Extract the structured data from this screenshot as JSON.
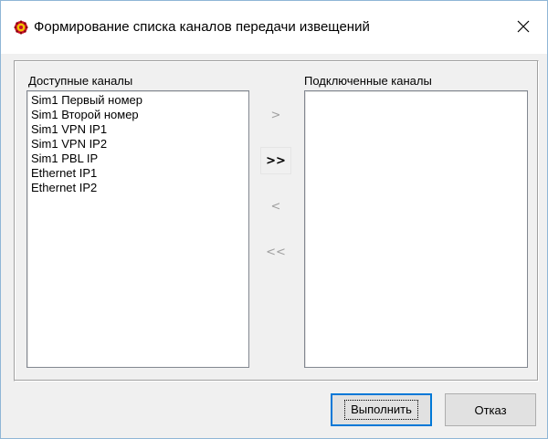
{
  "window": {
    "title": "Формирование списка каналов передачи извещений",
    "app_icon": "gear-red-icon",
    "close_icon": "close-icon"
  },
  "available": {
    "label": "Доступные каналы",
    "items": [
      "Sim1 Первый номер",
      "Sim1 Второй номер",
      "Sim1 VPN IP1",
      "Sim1 VPN IP2",
      "Sim1 PBL IP",
      "Ethernet IP1",
      "Ethernet IP2"
    ]
  },
  "connected": {
    "label": "Подключенные каналы",
    "items": []
  },
  "transfer": {
    "add_one": ">",
    "add_all": ">>",
    "remove_one": "<",
    "remove_all": "<<"
  },
  "buttons": {
    "ok_label": "Выполнить",
    "cancel_label": "Отказ"
  },
  "colors": {
    "accent": "#0078d7"
  }
}
